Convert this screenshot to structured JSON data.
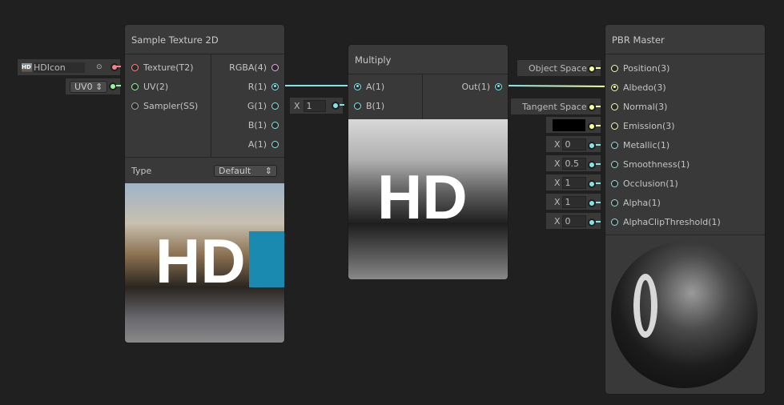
{
  "colors": {
    "canvas": "#202020",
    "node": "#393939",
    "vector1": "#84e4e7",
    "vector3": "#f6ff9a",
    "texture": "#f68383",
    "vector2": "#9af69a",
    "vector4": "#e9a8e9"
  },
  "sample_texture": {
    "title": "Sample Texture 2D",
    "inputs": [
      "Texture(T2)",
      "UV(2)",
      "Sampler(SS)"
    ],
    "outputs": [
      "RGBA(4)",
      "R(1)",
      "G(1)",
      "B(1)",
      "A(1)"
    ],
    "type_label": "Type",
    "type_value": "Default",
    "texture_field": "HDIcon",
    "uv_value": "UV0",
    "preview_text": "HD",
    "thumb_text": "HD"
  },
  "multiply": {
    "title": "Multiply",
    "inputs": [
      "A(1)",
      "B(1)"
    ],
    "output": "Out(1)",
    "b_axis": "X",
    "b_value": "1",
    "preview_text": "HD"
  },
  "pbr": {
    "title": "PBR Master",
    "inputs": [
      "Position(3)",
      "Albedo(3)",
      "Normal(3)",
      "Emission(3)",
      "Metallic(1)",
      "Smoothness(1)",
      "Occlusion(1)",
      "Alpha(1)",
      "AlphaClipThreshold(1)"
    ],
    "position_space": "Object Space",
    "normal_space": "Tangent Space",
    "emission_color": "#000000",
    "axis": "X",
    "metallic": "0",
    "smoothness": "0.5",
    "occlusion": "1",
    "alpha": "1",
    "alpha_clip": "0"
  }
}
